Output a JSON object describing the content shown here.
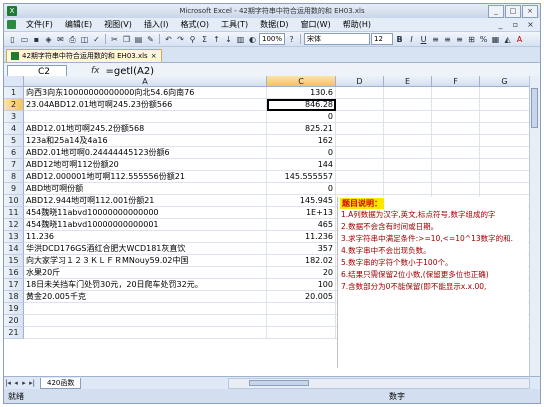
{
  "window": {
    "title": "Microsoft Excel - 42期字符串中符合运用数的和 EH03.xls",
    "buttons": [
      "_",
      "□",
      "×"
    ]
  },
  "menu": [
    "文件(F)",
    "编辑(E)",
    "视图(V)",
    "插入(I)",
    "格式(O)",
    "工具(T)",
    "数据(D)",
    "窗口(W)",
    "帮助(H)"
  ],
  "toolbar": {
    "font_name": "宋体",
    "font_size": "12",
    "zoom": "100%"
  },
  "file_tab": "42期字符串中符合运用数的和 EH03.xls",
  "formula_bar": {
    "name_box": "C2",
    "fx": "fx",
    "formula": "=getl(A2)"
  },
  "columns": [
    "A",
    "C",
    "D",
    "E",
    "F",
    "G"
  ],
  "rows": [
    {
      "n": "1",
      "a": "向西3向东10000000000000向北54.6向南76",
      "c": "130.6"
    },
    {
      "n": "2",
      "a": "23.04ABD12.01地可啊245.23份额566",
      "c": "846.28"
    },
    {
      "n": "3",
      "a": "",
      "c": "0"
    },
    {
      "n": "4",
      "a": "ABD12.01地可啊245.2份额568",
      "c": "825.21"
    },
    {
      "n": "5",
      "a": "123a和25a14及4a16",
      "c": "162"
    },
    {
      "n": "6",
      "a": "ABD2.01地可啊0.24444445123份额6",
      "c": "0"
    },
    {
      "n": "7",
      "a": "ABD12地可啊112份额20",
      "c": "144"
    },
    {
      "n": "8",
      "a": "ABD12.000001地可啊112.555556份额21",
      "c": "145.555557"
    },
    {
      "n": "9",
      "a": "ABD地可啊份额",
      "c": "0"
    },
    {
      "n": "10",
      "a": "ABD12.944地可啊112.001份额21",
      "c": "145.945"
    },
    {
      "n": "11",
      "a": "454魏晓11abvd10000000000000",
      "c": "1E+13"
    },
    {
      "n": "12",
      "a": "454魏晓11abvd10000000000001",
      "c": "465"
    },
    {
      "n": "13",
      "a": "11.236",
      "c": "11.236"
    },
    {
      "n": "14",
      "a": "华洪DCD176GS酒红合肥大WCD181灰直饮",
      "c": "357"
    },
    {
      "n": "15",
      "a": "向大家学习１２３ＫＬＦＲMNouy59.02中国",
      "c": "182.02"
    },
    {
      "n": "16",
      "a": "水果20斤",
      "c": "20"
    },
    {
      "n": "17",
      "a": "18日未关挡车门处罚30元，20日爬车处罚32元。",
      "c": "100"
    },
    {
      "n": "18",
      "a": "黄金20.005千克",
      "c": "20.005"
    },
    {
      "n": "19",
      "a": "",
      "c": ""
    },
    {
      "n": "20",
      "a": "",
      "c": ""
    },
    {
      "n": "21",
      "a": "",
      "c": ""
    }
  ],
  "note": {
    "title": "题目说明：",
    "lines": [
      "1.A列数据为汉字,英文,标点符号,数字组成的字",
      "2.数据不会含有时间或日期。",
      "3.求字符串中满足条件:>=10,<=10^13数字的和.",
      "4.数字串中不会出现负数。",
      "5.数字串的字符个数小于100个。",
      "6.结果只需保留2位小数,(保留更多位也正确)",
      "7.含数部分为0不能保留(即不能显示x.x.00,"
    ]
  },
  "sheet_tab": "420函数",
  "status": {
    "left": "就绪",
    "mid": "数字"
  }
}
